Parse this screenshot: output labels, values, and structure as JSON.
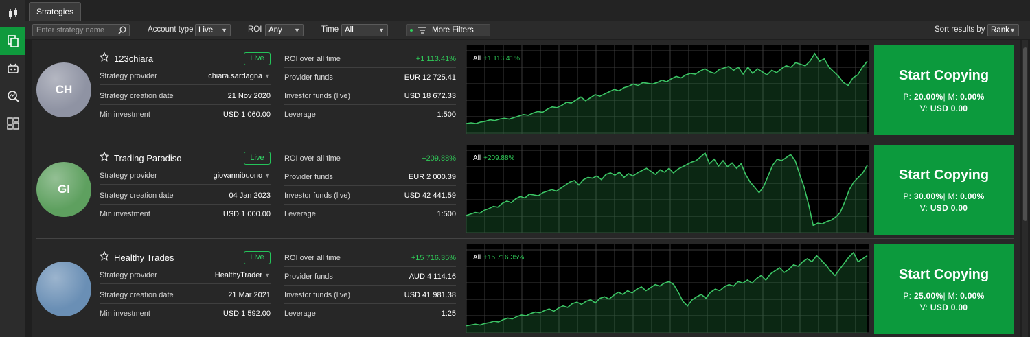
{
  "tab": "Strategies",
  "filters": {
    "search_placeholder": "Enter strategy name",
    "account_type_label": "Account type",
    "account_type_value": "Live",
    "roi_label": "ROI",
    "roi_value": "Any",
    "time_label": "Time",
    "time_value": "All",
    "more_filters": "More Filters",
    "sort_label": "Sort results by",
    "sort_value": "Rank"
  },
  "sidebar_icons": [
    "candlestick-icon",
    "copy-icon",
    "robot-icon",
    "search-analytics-icon",
    "dashboard-icon"
  ],
  "labels": {
    "provider": "Strategy provider",
    "creation": "Strategy creation date",
    "min_investment": "Min investment",
    "roi": "ROI over all time",
    "provider_funds": "Provider funds",
    "investor_funds": "Investor funds (live)",
    "leverage": "Leverage",
    "chart_period": "All",
    "start_copying": "Start Copying",
    "p_prefix": "P:",
    "m_prefix": "| M:",
    "v_prefix": "V:"
  },
  "strategies": [
    {
      "initials": "CH",
      "name": "123chiara",
      "badge": "Live",
      "provider": "chiara.sardagna",
      "creation_date": "21 Nov 2020",
      "min_investment": "USD 1 060.00",
      "roi": "+1 113.41%",
      "provider_funds": "EUR 12 725.41",
      "investor_funds": "USD 18 672.33",
      "leverage": "1:500",
      "p": "20.00%",
      "m": "0.00%",
      "v": "USD 0.00",
      "avatar_color": "#8f93a3",
      "equity_curve": [
        0.08,
        0.09,
        0.08,
        0.1,
        0.11,
        0.13,
        0.12,
        0.14,
        0.15,
        0.14,
        0.16,
        0.18,
        0.2,
        0.19,
        0.22,
        0.24,
        0.23,
        0.27,
        0.3,
        0.29,
        0.32,
        0.36,
        0.35,
        0.39,
        0.43,
        0.38,
        0.42,
        0.46,
        0.44,
        0.47,
        0.5,
        0.53,
        0.51,
        0.55,
        0.57,
        0.6,
        0.58,
        0.62,
        0.61,
        0.6,
        0.62,
        0.65,
        0.63,
        0.67,
        0.7,
        0.68,
        0.72,
        0.74,
        0.73,
        0.77,
        0.8,
        0.76,
        0.74,
        0.79,
        0.81,
        0.83,
        0.78,
        0.82,
        0.73,
        0.82,
        0.74,
        0.8,
        0.76,
        0.72,
        0.78,
        0.75,
        0.8,
        0.84,
        0.82,
        0.88,
        0.86,
        0.84,
        0.9,
        1.0,
        0.9,
        0.93,
        0.82,
        0.76,
        0.7,
        0.62,
        0.58,
        0.68,
        0.72,
        0.82,
        0.9
      ]
    },
    {
      "initials": "GI",
      "name": "Trading Paradiso",
      "badge": "Live",
      "provider": "giovannibuono",
      "creation_date": "04 Jan 2023",
      "min_investment": "USD 1 000.00",
      "roi": "+209.88%",
      "provider_funds": "EUR 2 000.39",
      "investor_funds": "USD 42 441.59",
      "leverage": "1:500",
      "p": "30.00%",
      "m": "0.00%",
      "v": "USD 0.00",
      "avatar_color": "#5ea05f",
      "equity_curve": [
        0.18,
        0.2,
        0.22,
        0.21,
        0.25,
        0.27,
        0.3,
        0.29,
        0.34,
        0.37,
        0.35,
        0.4,
        0.43,
        0.41,
        0.46,
        0.45,
        0.44,
        0.48,
        0.5,
        0.52,
        0.5,
        0.54,
        0.58,
        0.62,
        0.64,
        0.58,
        0.65,
        0.68,
        0.67,
        0.7,
        0.65,
        0.72,
        0.74,
        0.71,
        0.75,
        0.68,
        0.73,
        0.7,
        0.74,
        0.77,
        0.8,
        0.76,
        0.72,
        0.78,
        0.75,
        0.8,
        0.74,
        0.79,
        0.82,
        0.85,
        0.88,
        0.9,
        0.95,
        1.0,
        0.86,
        0.92,
        0.83,
        0.9,
        0.82,
        0.87,
        0.8,
        0.86,
        0.72,
        0.62,
        0.55,
        0.48,
        0.56,
        0.7,
        0.84,
        0.92,
        0.9,
        0.94,
        0.98,
        0.9,
        0.72,
        0.55,
        0.32,
        0.05,
        0.08,
        0.07,
        0.1,
        0.12,
        0.16,
        0.22,
        0.36,
        0.52,
        0.62,
        0.68,
        0.74,
        0.84
      ]
    },
    {
      "initials": "",
      "name": "Healthy Trades",
      "badge": "Live",
      "provider": "HealthyTrader",
      "creation_date": "21 Mar 2021",
      "min_investment": "USD 1 592.00",
      "roi": "+15 716.35%",
      "provider_funds": "AUD 4 114.16",
      "investor_funds": "USD 41 981.38",
      "leverage": "1:25",
      "p": "25.00%",
      "m": "0.00%",
      "v": "USD 0.00",
      "avatar_color": "#6a8fb5",
      "equity_curve": [
        0.04,
        0.05,
        0.06,
        0.05,
        0.07,
        0.08,
        0.1,
        0.09,
        0.12,
        0.14,
        0.13,
        0.16,
        0.18,
        0.17,
        0.2,
        0.22,
        0.21,
        0.24,
        0.26,
        0.23,
        0.27,
        0.3,
        0.28,
        0.33,
        0.35,
        0.32,
        0.36,
        0.38,
        0.34,
        0.4,
        0.42,
        0.39,
        0.44,
        0.48,
        0.45,
        0.5,
        0.47,
        0.52,
        0.55,
        0.5,
        0.54,
        0.58,
        0.56,
        0.6,
        0.62,
        0.58,
        0.48,
        0.36,
        0.3,
        0.38,
        0.42,
        0.45,
        0.4,
        0.48,
        0.52,
        0.5,
        0.55,
        0.58,
        0.56,
        0.62,
        0.6,
        0.64,
        0.6,
        0.66,
        0.7,
        0.64,
        0.72,
        0.76,
        0.8,
        0.74,
        0.78,
        0.84,
        0.82,
        0.88,
        0.92,
        0.88,
        0.96,
        0.9,
        0.84,
        0.76,
        0.7,
        0.78,
        0.86,
        0.94,
        1.0,
        0.88,
        0.92,
        0.96
      ]
    }
  ]
}
